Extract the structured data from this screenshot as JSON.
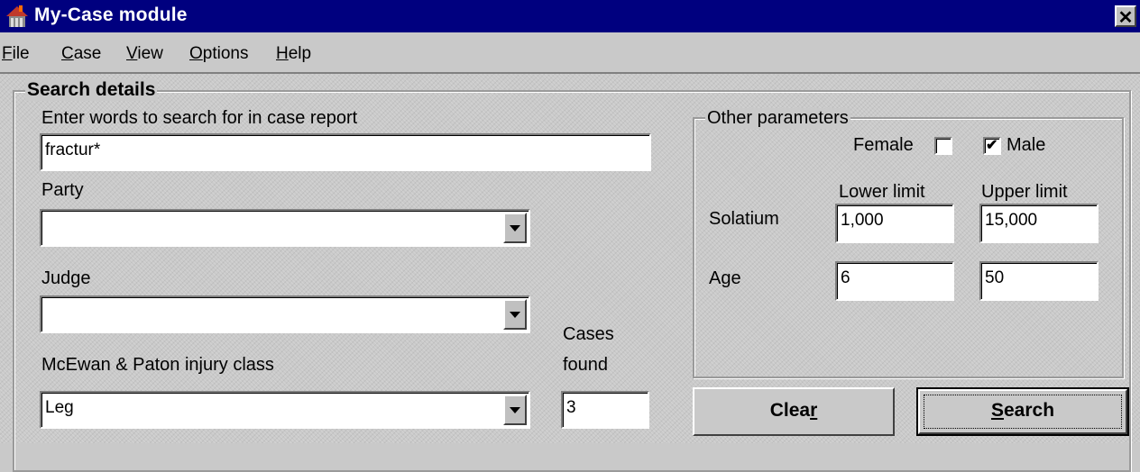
{
  "window": {
    "title": "My-Case module",
    "close_glyph": "✕",
    "icon": "app-icon"
  },
  "menu": {
    "file": {
      "pre": "F",
      "rest": "ile"
    },
    "case": {
      "pre": "C",
      "rest": "ase"
    },
    "view": {
      "pre": "V",
      "rest": "iew"
    },
    "options": {
      "pre": "O",
      "rest": "ptions"
    },
    "help": {
      "pre": "H",
      "rest": "elp"
    }
  },
  "search": {
    "group_title": "Search details",
    "words_label": "Enter words to search for in case report",
    "words_value": "fractur*",
    "party_label": "Party",
    "party_value": "",
    "judge_label": "Judge",
    "judge_value": "",
    "injury_label": "McEwan & Paton injury class",
    "injury_value": "Leg",
    "cases_found_label_1": "Cases",
    "cases_found_label_2": "found",
    "cases_found_value": "3"
  },
  "params": {
    "group_title": "Other parameters",
    "female_label": "Female",
    "female_checked": false,
    "male_label": "Male",
    "male_checked": true,
    "lower_limit_label": "Lower limit",
    "upper_limit_label": "Upper limit",
    "solatium_label": "Solatium",
    "solatium_lower": "1,000",
    "solatium_upper": "15,000",
    "age_label": "Age",
    "age_lower": "6",
    "age_upper": "50"
  },
  "buttons": {
    "clear_pre": "Clea",
    "clear_u": "r",
    "search_u": "S",
    "search_rest": "earch"
  },
  "colors": {
    "titlebar": "#00007f",
    "face": "#c9c9c9"
  }
}
